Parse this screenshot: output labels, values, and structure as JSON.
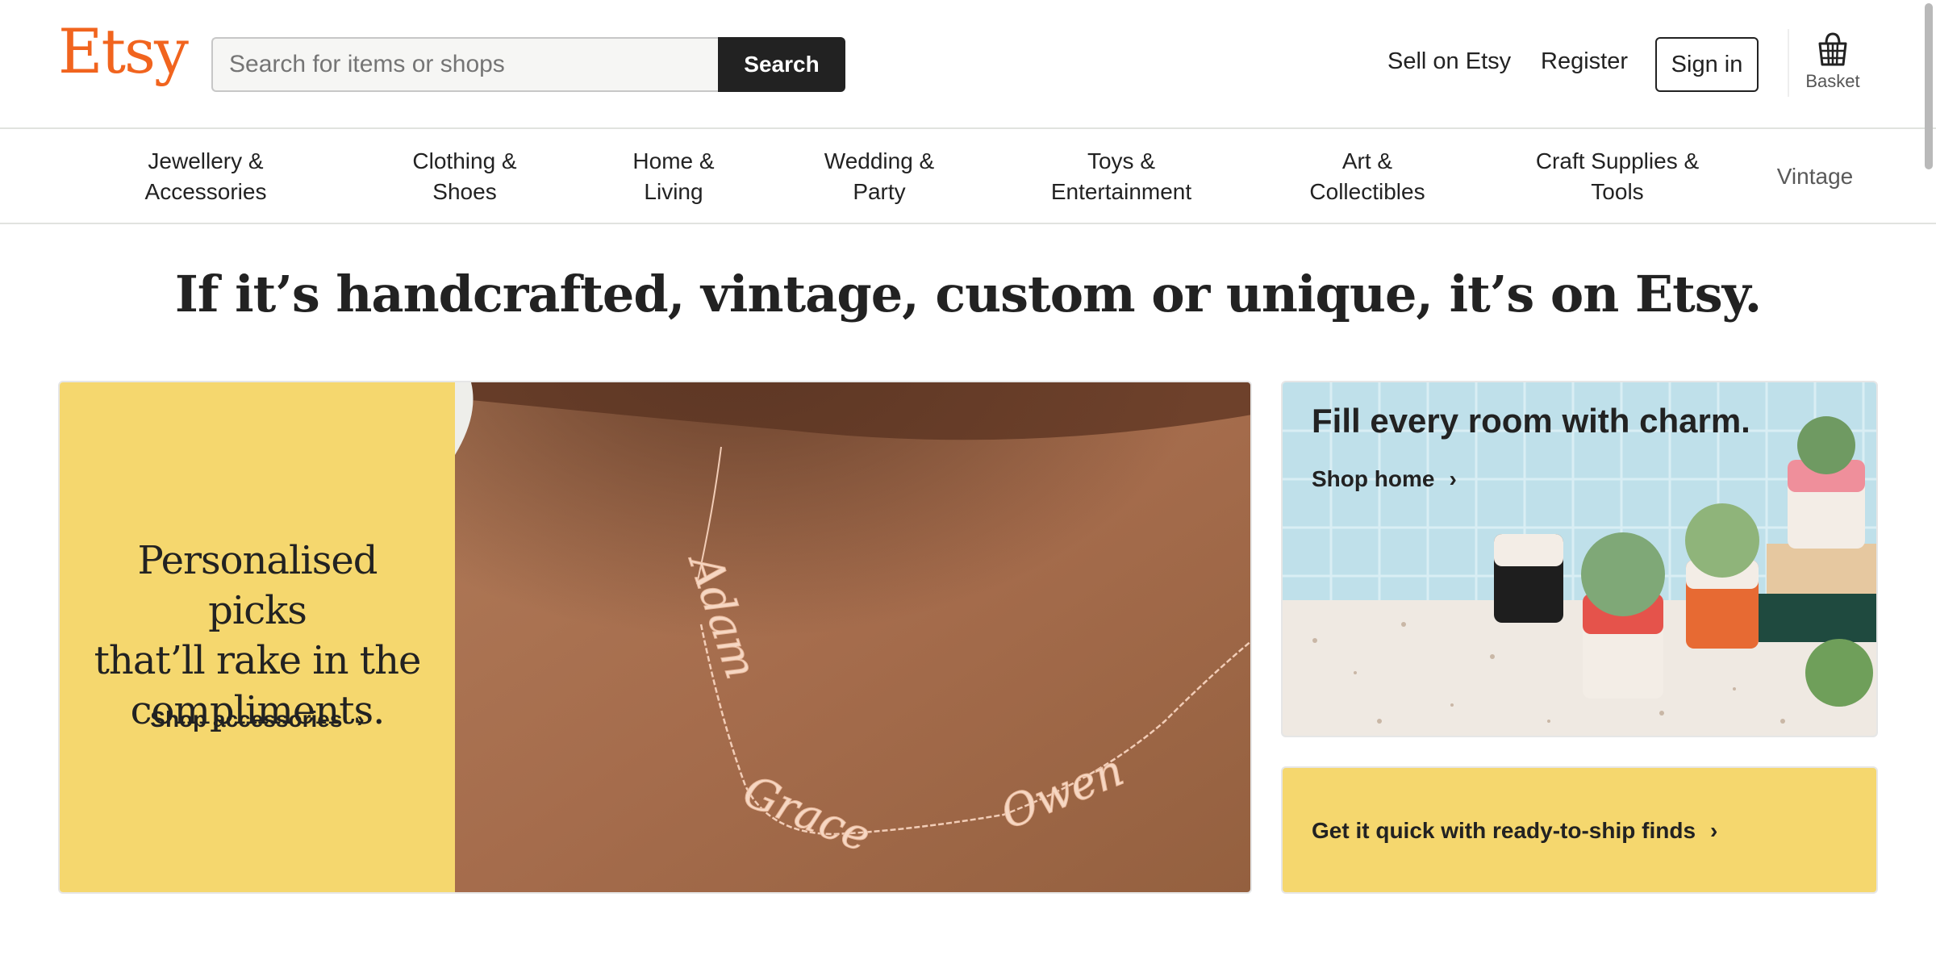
{
  "header": {
    "logo": "Etsy",
    "search_placeholder": "Search for items or shops",
    "search_button": "Search",
    "sell_link": "Sell on Etsy",
    "register_link": "Register",
    "signin_button": "Sign in",
    "basket_label": "Basket"
  },
  "categories": [
    {
      "line1": "Jewellery &",
      "line2": "Accessories"
    },
    {
      "line1": "Clothing &",
      "line2": "Shoes"
    },
    {
      "line1": "Home &",
      "line2": "Living"
    },
    {
      "line1": "Wedding &",
      "line2": "Party"
    },
    {
      "line1": "Toys &",
      "line2": "Entertainment"
    },
    {
      "line1": "Art &",
      "line2": "Collectibles"
    },
    {
      "line1": "Craft Supplies &",
      "line2": "Tools"
    },
    {
      "line1": "Vintage",
      "line2": ""
    }
  ],
  "hero": {
    "tagline": "If it’s handcrafted, vintage, custom or unique, it’s on Etsy."
  },
  "promo": {
    "title_line1": "Personalised picks",
    "title_line2": "that’ll rake in the",
    "title_line3": "compliments.",
    "link": "Shop accessories",
    "necklace_names": [
      "Adam",
      "Grace",
      "Owen"
    ]
  },
  "home_card": {
    "title": "Fill every room with charm.",
    "link": "Shop home"
  },
  "ship_card": {
    "link": "Get it quick with ready-to-ship finds"
  },
  "icons": {
    "chevron": "›",
    "basket": "basket-icon"
  },
  "colors": {
    "brand": "#f1641e",
    "promo_yellow": "#f5d76e",
    "dark": "#222222"
  }
}
